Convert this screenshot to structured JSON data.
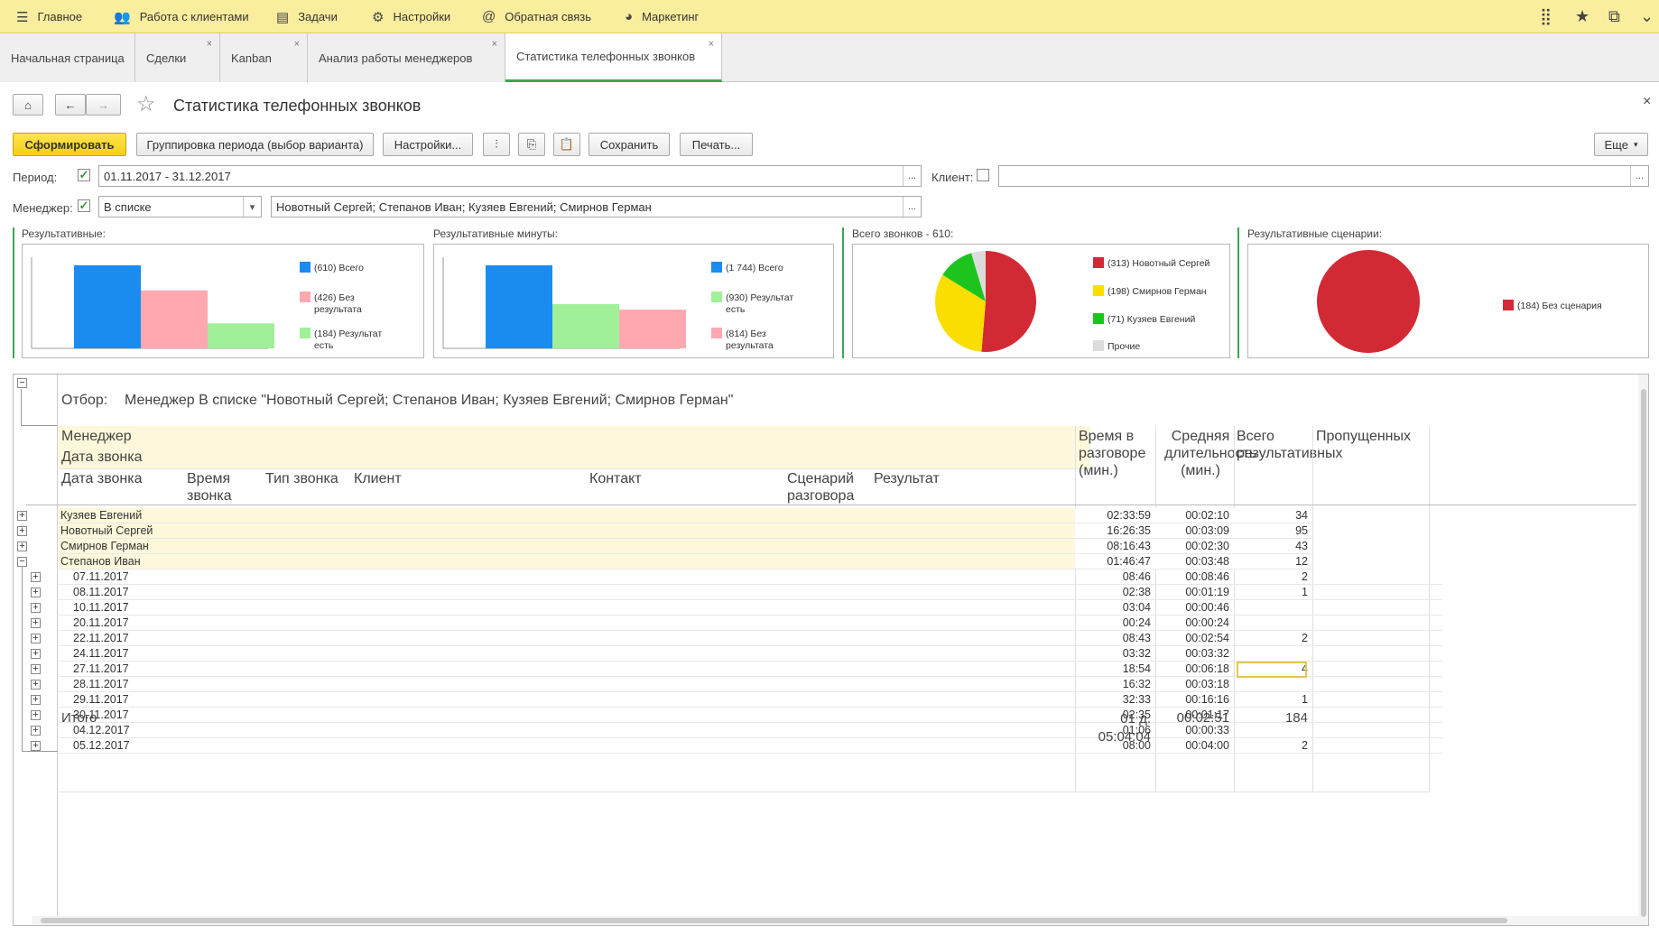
{
  "topnav": {
    "items": [
      "Главное",
      "Работа с клиентами",
      "Задачи",
      "Настройки",
      "Обратная связь",
      "Маркетинг"
    ]
  },
  "tabs": [
    {
      "label": "Начальная страница"
    },
    {
      "label": "Сделки"
    },
    {
      "label": "Kanban"
    },
    {
      "label": "Анализ работы менеджеров"
    },
    {
      "label": "Статистика телефонных звонков"
    }
  ],
  "page": {
    "title": "Статистика телефонных звонков"
  },
  "toolbar": {
    "generate": "Сформировать",
    "grouping": "Группировка периода (выбор варианта)",
    "settings": "Настройки...",
    "save": "Сохранить",
    "print": "Печать...",
    "more": "Еще"
  },
  "filters": {
    "period_label": "Период:",
    "period_value": "01.11.2017 - 31.12.2017",
    "client_label": "Клиент:",
    "client_value": "",
    "manager_label": "Менеджер:",
    "manager_mode": "В списке",
    "manager_value": "Новотный Сергей; Степанов Иван; Кузяев Евгений; Смирнов Герман"
  },
  "chart_data": [
    {
      "type": "bar",
      "title": "Результативные:",
      "categories": [
        "(610) Всего",
        "(426) Без результата",
        "(184) Результат есть"
      ],
      "values": [
        610,
        426,
        184
      ],
      "colors": [
        "#1a8cf0",
        "#ffa8b0",
        "#a0f09a"
      ]
    },
    {
      "type": "bar",
      "title": "Результативные минуты:",
      "categories": [
        "(1 744) Всего",
        "(930) Результат есть",
        "(814) Без результата"
      ],
      "values": [
        1744,
        930,
        814
      ],
      "colors": [
        "#1a8cf0",
        "#a0f09a",
        "#ffa8b0"
      ]
    },
    {
      "type": "pie",
      "title": "Всего звонков - 610:",
      "categories": [
        "(313) Новотный Сергей",
        "(198) Смирнов Герман",
        "(71) Кузяев Евгений",
        "Прочие"
      ],
      "values": [
        313,
        198,
        71,
        28
      ],
      "colors": [
        "#d22a35",
        "#fade00",
        "#1ec41e",
        "#dcdcdc"
      ]
    },
    {
      "type": "pie",
      "title": "Результативные сценарии:",
      "categories": [
        "(184) Без сценария"
      ],
      "values": [
        184
      ],
      "colors": [
        "#d22a35"
      ]
    }
  ],
  "report": {
    "filter_label": "Отбор:",
    "filter_text": "Менеджер В списке \"Новотный Сергей; Степанов Иван; Кузяев Евгений; Смирнов Герман\"",
    "headers": {
      "manager": "Менеджер",
      "call_date": "Дата звонка",
      "call_date2": "Дата звонка",
      "call_time": "Время звонка",
      "call_type": "Тип звонка",
      "client": "Клиент",
      "contact": "Контакт",
      "scenario": "Сценарий разговора",
      "result": "Результат",
      "talk_time": "Время в разговоре (мин.)",
      "avg_duration": "Средняя длительность (мин.)",
      "total_result": "Всего результативных",
      "missed": "Пропущенных"
    },
    "groups": [
      {
        "name": "Кузяев Евгений",
        "talk": "02:33:59",
        "avg": "00:02:10",
        "res": "34"
      },
      {
        "name": "Новотный Сергей",
        "talk": "16:26:35",
        "avg": "00:03:09",
        "res": "95"
      },
      {
        "name": "Смирнов Герман",
        "talk": "08:16:43",
        "avg": "00:02:30",
        "res": "43"
      },
      {
        "name": "Степанов Иван",
        "talk": "01:46:47",
        "avg": "00:03:48",
        "res": "12"
      }
    ],
    "dates": [
      {
        "name": "07.11.2017",
        "talk": "08:46",
        "avg": "00:08:46",
        "res": "2"
      },
      {
        "name": "08.11.2017",
        "talk": "02:38",
        "avg": "00:01:19",
        "res": "1"
      },
      {
        "name": "10.11.2017",
        "talk": "03:04",
        "avg": "00:00:46",
        "res": ""
      },
      {
        "name": "20.11.2017",
        "talk": "00:24",
        "avg": "00:00:24",
        "res": ""
      },
      {
        "name": "22.11.2017",
        "talk": "08:43",
        "avg": "00:02:54",
        "res": "2"
      },
      {
        "name": "24.11.2017",
        "talk": "03:32",
        "avg": "00:03:32",
        "res": ""
      },
      {
        "name": "27.11.2017",
        "talk": "18:54",
        "avg": "00:06:18",
        "res": "4"
      },
      {
        "name": "28.11.2017",
        "talk": "16:32",
        "avg": "00:03:18",
        "res": ""
      },
      {
        "name": "29.11.2017",
        "talk": "32:33",
        "avg": "00:16:16",
        "res": "1"
      },
      {
        "name": "30.11.2017",
        "talk": "02:35",
        "avg": "00:01:17",
        "res": ""
      },
      {
        "name": "04.12.2017",
        "talk": "01:06",
        "avg": "00:00:33",
        "res": ""
      },
      {
        "name": "05.12.2017",
        "talk": "08:00",
        "avg": "00:04:00",
        "res": "2"
      }
    ],
    "total": {
      "label": "Итого",
      "talk1": "01 д.",
      "talk2": "05:04:04",
      "avg": "00:02:51",
      "res": "184"
    }
  }
}
